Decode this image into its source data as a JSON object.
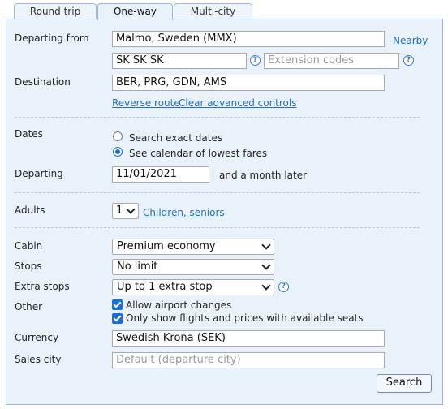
{
  "tabs": [
    "Round trip",
    "One-way",
    "Multi-city"
  ],
  "form": {
    "departing_from_label": "Departing from",
    "departing_from_value": "Malmo, Sweden (MMX)",
    "nearby_link": "Nearby",
    "routing_codes_value": "SK SK SK",
    "extension_codes_placeholder": "Extension codes",
    "destination_label": "Destination",
    "destination_value": "BER, PRG, GDN, AMS",
    "reverse_route_link": "Reverse route",
    "clear_advanced_link": "Clear advanced controls",
    "dates_label": "Dates",
    "radio_exact": "Search exact dates",
    "radio_calendar": "See calendar of lowest fares",
    "departing_label": "Departing",
    "departing_date": "11/01/2021",
    "and_a_month_later": "and a month later",
    "adults_label": "Adults",
    "adults_value": "1",
    "children_seniors_link": "Children, seniors",
    "cabin_label": "Cabin",
    "cabin_value": "Premium economy",
    "stops_label": "Stops",
    "stops_value": "No limit",
    "extra_stops_label": "Extra stops",
    "extra_stops_value": "Up to 1 extra stop",
    "other_label": "Other",
    "allow_airport_changes": "Allow airport changes",
    "only_show_available": "Only show flights and prices with available seats",
    "currency_label": "Currency",
    "currency_value": "Swedish Krona (SEK)",
    "sales_city_label": "Sales city",
    "sales_city_placeholder": "Default (departure city)",
    "search_button": "Search",
    "help_glyph": "?"
  },
  "icons": {
    "help": "help-circle-icon",
    "dropdown": "chevron-down-icon",
    "check": "checkmark-icon"
  },
  "colors": {
    "panel_bg": "#e9f2fb",
    "border": "#9ab8d3",
    "link": "#2a6db4",
    "accent": "#1a6fd8"
  }
}
